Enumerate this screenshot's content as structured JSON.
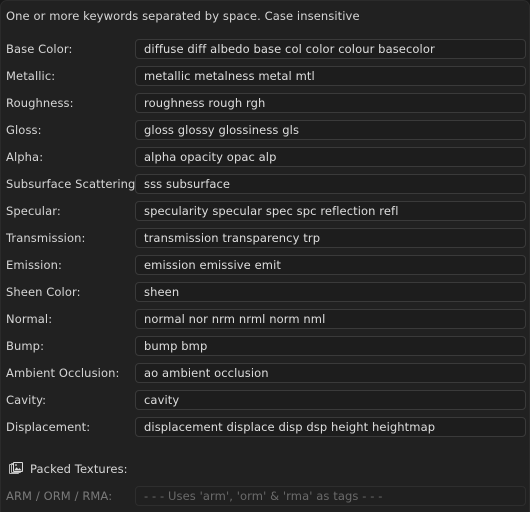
{
  "panel": {
    "header_note": "One or more keywords separated by space. Case insensitive",
    "colors": {
      "outer_background": "#181818",
      "panel_background": "#212121",
      "field_background": "#1d1d1d",
      "field_border": "#3a3a3a",
      "text": "#d6d6d6",
      "field_text": "#dedede",
      "disabled_text": "#6b6b6b",
      "disabled_label": "#7a7a7a"
    }
  },
  "keyword_rows": [
    {
      "label": "Base Color:",
      "value": "diffuse diff albedo base col color colour basecolor"
    },
    {
      "label": "Metallic:",
      "value": "metallic metalness metal mtl"
    },
    {
      "label": "Roughness:",
      "value": "roughness rough rgh"
    },
    {
      "label": "Gloss:",
      "value": "gloss glossy glossiness gls"
    },
    {
      "label": "Alpha:",
      "value": "alpha opacity opac alp"
    },
    {
      "label": "Subsurface Scattering:",
      "value": "sss subsurface"
    },
    {
      "label": "Specular:",
      "value": "specularity specular spec spc reflection refl"
    },
    {
      "label": "Transmission:",
      "value": "transmission transparency trp"
    },
    {
      "label": "Emission:",
      "value": "emission emissive emit"
    },
    {
      "label": "Sheen Color:",
      "value": "sheen"
    },
    {
      "label": "Normal:",
      "value": "normal nor nrm nrml norm nml"
    },
    {
      "label": "Bump:",
      "value": "bump bmp"
    },
    {
      "label": "Ambient Occlusion:",
      "value": "ao ambient occlusion"
    },
    {
      "label": "Cavity:",
      "value": "cavity"
    },
    {
      "label": "Displacement:",
      "value": "displacement displace disp dsp height heightmap"
    }
  ],
  "packed_textures": {
    "icon": "packed-images-icon",
    "title": "Packed Textures:",
    "row": {
      "label": "ARM / ORM / RMA:",
      "value": "- - - Uses 'arm', 'orm' & 'rma' as tags - - -",
      "disabled": true
    }
  }
}
